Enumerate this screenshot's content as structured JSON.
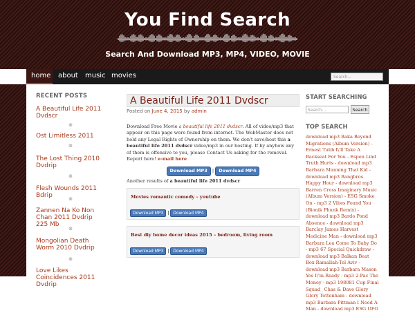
{
  "header": {
    "site_title": "You Find Search",
    "tagline": "Search And Download MP3, MP4, VIDEO, MOVIE"
  },
  "nav": {
    "items": [
      "home",
      "about",
      "music",
      "movies"
    ],
    "search_placeholder": "Search..."
  },
  "sidebar": {
    "heading": "RECENT POSTS",
    "posts": [
      "A Beautiful Life 2011 Dvdscr",
      "Ost Limitless 2011",
      "The Lost Thing 2010 Dvdrip",
      "Flesh Wounds 2011 Bdrip",
      "Zannen Na Ko Non Chan 2011 Dvdrip 225 Mb",
      "Mongolian Death Worm 2010 Dvdrip",
      "Love Likes Coincidences 2011 Dvdrip"
    ]
  },
  "post": {
    "title": "A Beautiful Life 2011 Dvdscr",
    "posted_on": "Posted on",
    "date": "June 4, 2015",
    "by": "by",
    "author": "admin",
    "intro_prefix": "Download Free Movie",
    "intro_italic": "a beautiful life 2011 dvdscr",
    "intro_text": ". All of video/mp3 that appear on this page were found from internet. The WebMaster does not hold any Legal Rights of Ownership on them. We don't save/host this",
    "intro_bold": "a beautiful life 2011 dvdscr",
    "intro_text2": "video/mp3 in our hosting. If by anyhow any of them is offensive to you, please Contact Us asking for the removal. Report here!",
    "email_link": "e-mail here",
    "btn_mp3": "Download MP3",
    "btn_sep": "|",
    "btn_mp4": "Download MP4",
    "another_prefix": "Another results of",
    "another_bold": "a beautiful life 2011 dvdscr",
    "results": [
      {
        "title": "Movies romantic comedy – youtube",
        "mp3": "Download MP3",
        "mp4": "Download MP4"
      },
      {
        "title": "Best diy home decor ideas 2015 – bedroom, living room",
        "mp3": "Download MP3",
        "mp4": "Download MP4"
      }
    ]
  },
  "right": {
    "search_heading": "START SEARCHING",
    "search_placeholder": "Search...",
    "search_button": "Search",
    "top_heading": "TOP SEARCH",
    "top_text": "download mp3 Baka Beyond Migrations (Album Version) - Ernest Tubb I\\'ll Take A Backseat For You - Espen Lind Truth Hurts - download mp3 Barbara Manning That Kid - download mp3 Bangbros Happy Hour - download mp3 Barren Cross Imaginary Music (Album Version) - ESG Smoke On - mp3 2 Vibes Found You (Bionik Phunk Remix) - download mp3 Bardo Pond Absence - download mp3 Barclay James Harvest Medicine Man - download mp3 Barbara Lea Come To Baby Do - mp3 67 Special Quickdraw - download mp3 Balkan Beat Box Ramallah-Tel Aviv - download mp3 Barbara Mason Yes I\\'m Ready - mp3 2-Pac The Money - mp3 198081 Cup Final Squad_ Chas & Dave Glory Glory Tottenham - download mp3 Barbara Pittman I Need A Man - download mp3 ESG UFO"
  },
  "colors": {
    "header_bg": "#3a1410",
    "nav_bg": "#1a1a1a",
    "accent_red": "#a83a1c",
    "button_blue": "#4a79b8"
  }
}
